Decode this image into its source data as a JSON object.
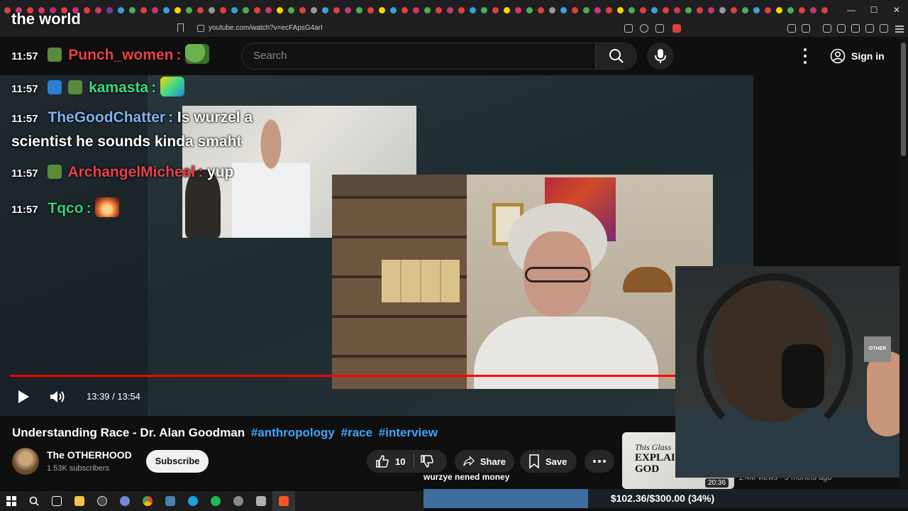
{
  "banner": {
    "text": "the world"
  },
  "browser": {
    "url": "youtube.com/watch?v=ecFApsG4arI"
  },
  "youtube": {
    "search_placeholder": "Search",
    "signin_label": "Sign in"
  },
  "chat": [
    {
      "time": "11:57",
      "name": "Punch_women",
      "name_color": "#e8414a",
      "message": "",
      "emote": "pepe-emote"
    },
    {
      "time": "11:57",
      "name": "kamasta",
      "name_color": "#3ddc84",
      "message": "",
      "emote": "w-emote"
    },
    {
      "time": "11:57",
      "name": "TheGoodChatter",
      "name_color": "#7fb2f0",
      "message": "Is wurzel a",
      "message2": "scientist he sounds kinda smaht"
    },
    {
      "time": "11:57",
      "name": "ArchangelMicheal",
      "name_color": "#e8414a",
      "message": "yup"
    },
    {
      "time": "11:57",
      "name": "Tqco",
      "name_color": "#33d17a",
      "message": "",
      "emote": "explosion-emote"
    }
  ],
  "player": {
    "current_time": "13:39",
    "duration": "13:54",
    "time_display": "13:39 / 13:54",
    "progress_fraction": 0.9832,
    "accent_color": "#ff0000"
  },
  "video": {
    "title": "Understanding Race - Dr. Alan Goodman",
    "hashtags": [
      "#anthropology",
      "#race",
      "#interview"
    ],
    "channel_name": "The OTHERHOOD",
    "subscribers": "1.53K subscribers",
    "subscribe_label": "Subscribe",
    "likes": "10",
    "share_label": "Share",
    "save_label": "Save"
  },
  "related": {
    "thumb_line1": "This Glass",
    "thumb_line2": "EXPLAINS",
    "thumb_line3": "GOD",
    "duration": "20:36",
    "meta": "1.4M views · 3 months ago"
  },
  "webcam": {
    "logo_text": "OTHER"
  },
  "donation": {
    "label": "wurzye nened money",
    "text": "$102.36/$300.00 (34%)",
    "fraction": 0.34,
    "fill_color": "#3f6d9e"
  }
}
